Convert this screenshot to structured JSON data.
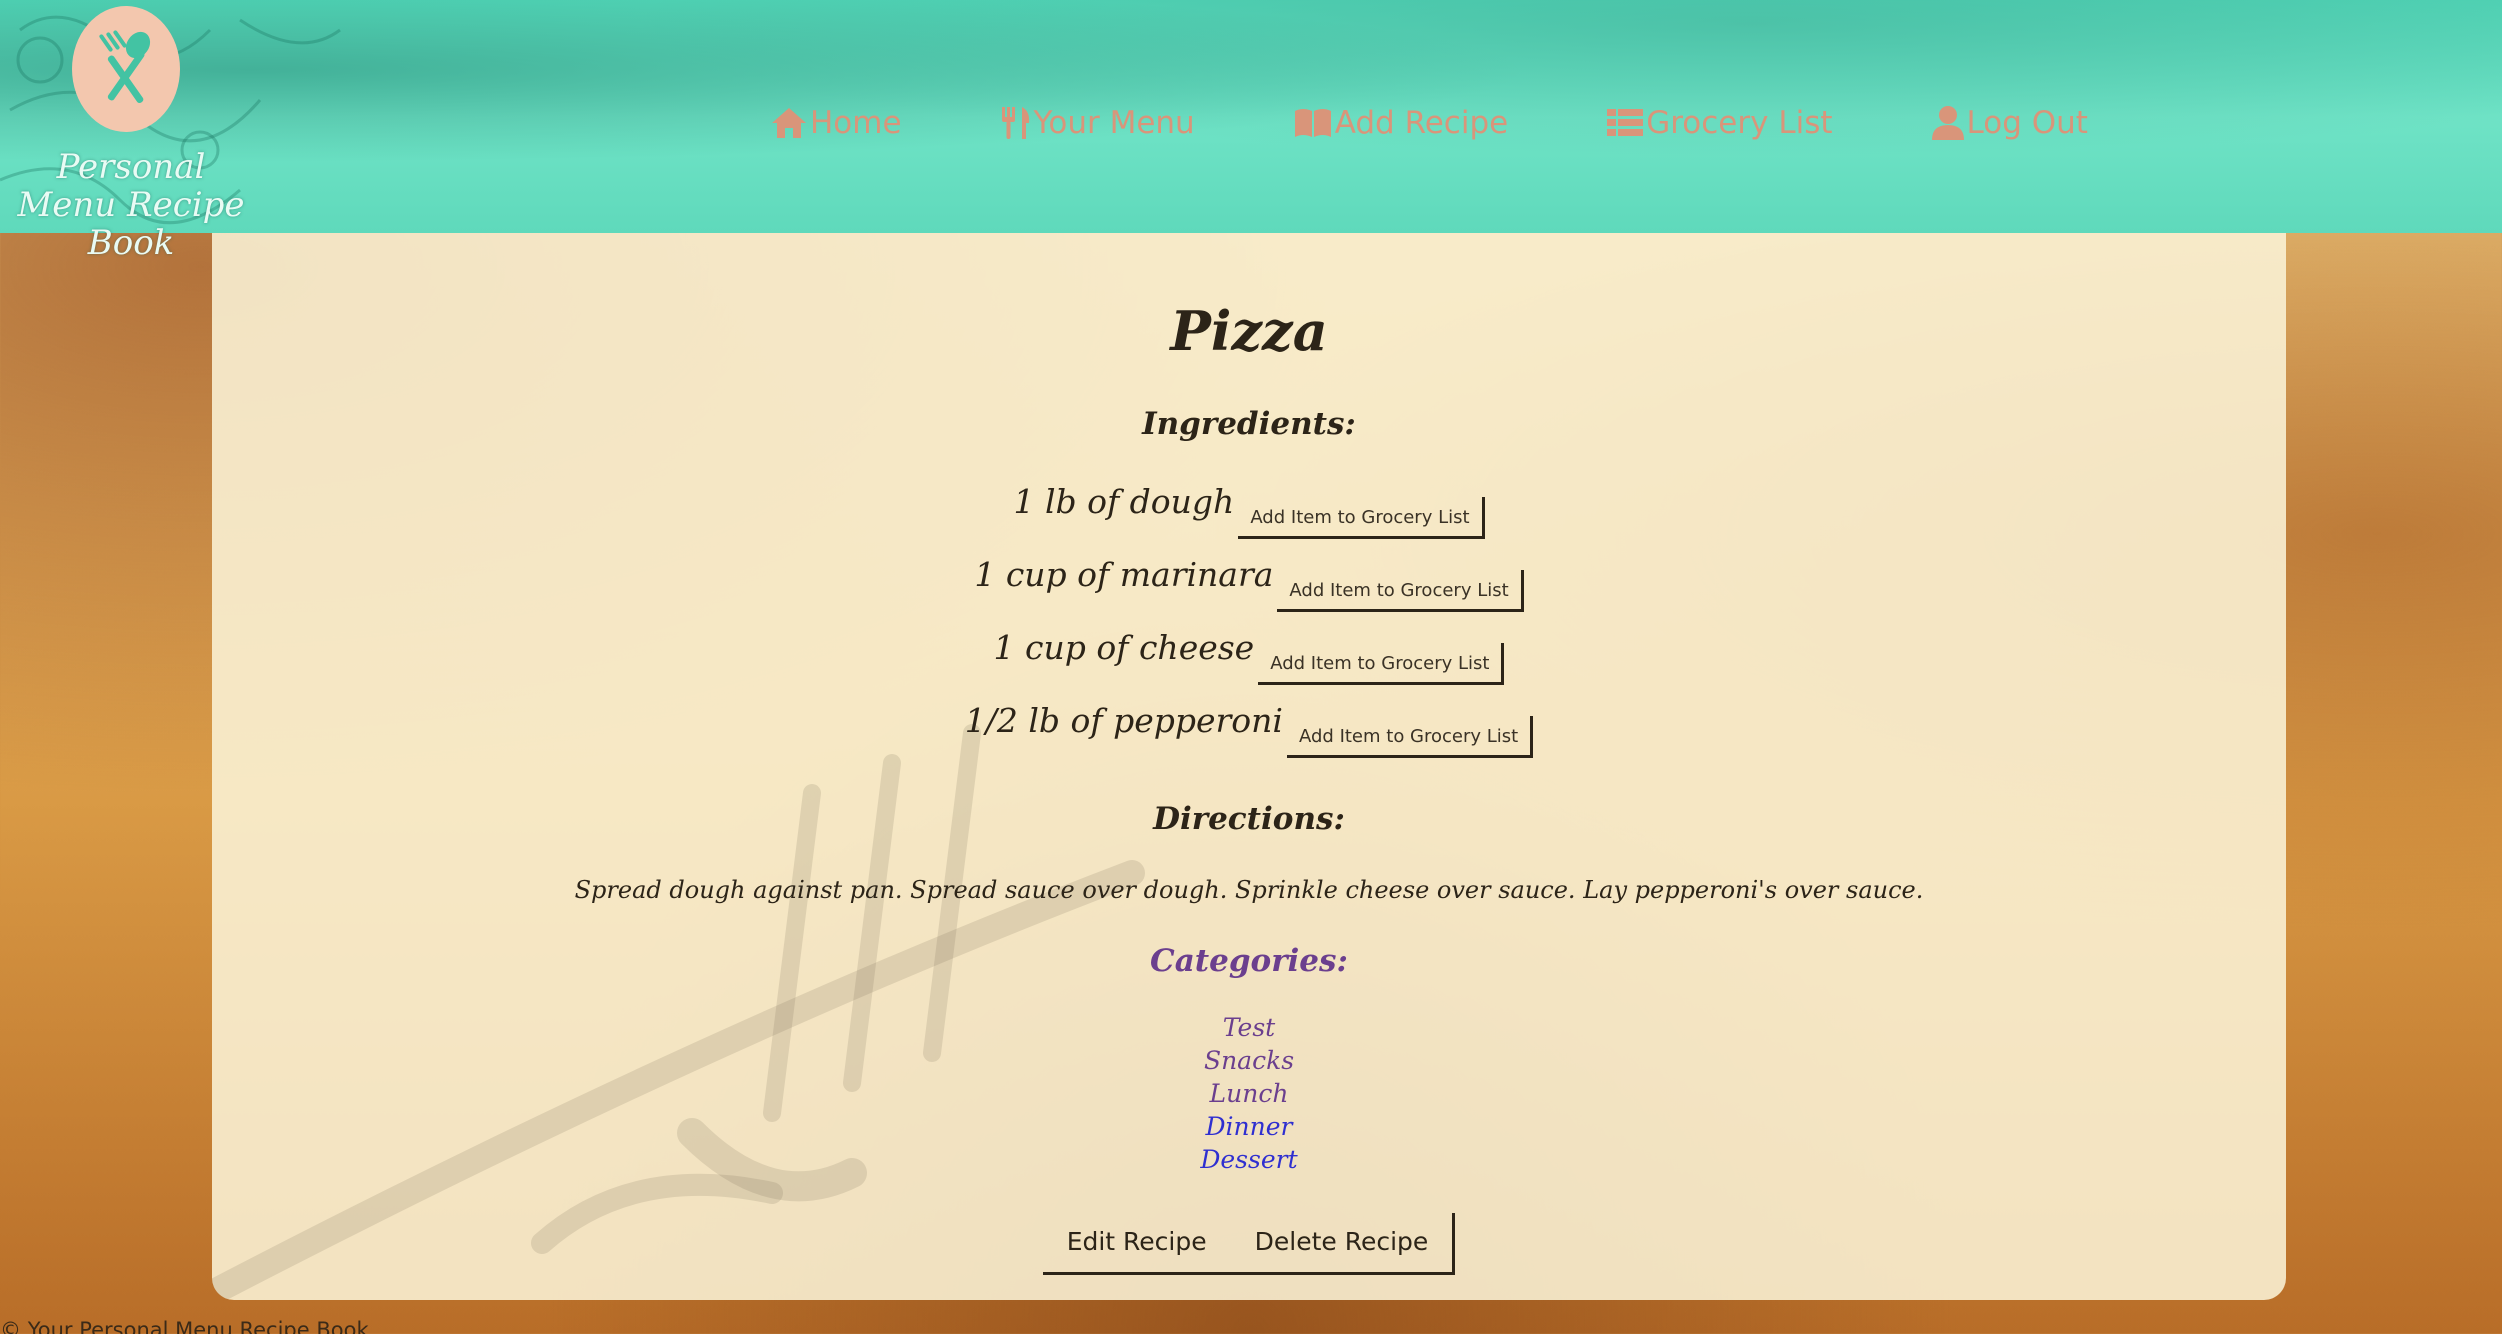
{
  "brand": {
    "line1": "Personal",
    "line2": "Menu Recipe Book"
  },
  "nav": {
    "home": "Home",
    "your_menu": "Your Menu",
    "add_recipe": "Add Recipe",
    "grocery_list": "Grocery List",
    "log_out": "Log Out"
  },
  "recipe": {
    "title": "Pizza",
    "ingredients_heading": "Ingredients:",
    "ingredients": [
      {
        "text": "1 lb of dough",
        "button": "Add Item to Grocery List"
      },
      {
        "text": "1 cup of marinara",
        "button": "Add Item to Grocery List"
      },
      {
        "text": "1 cup of cheese",
        "button": "Add Item to Grocery List"
      },
      {
        "text": "1/2 lb of pepperoni",
        "button": "Add Item to Grocery List"
      }
    ],
    "directions_heading": "Directions:",
    "directions": "Spread dough against pan. Spread sauce over dough. Sprinkle cheese over sauce. Lay pepperoni's over sauce.",
    "categories_heading": "Categories:",
    "categories": [
      "Test",
      "Snacks",
      "Lunch",
      "Dinner",
      "Dessert"
    ]
  },
  "actions": {
    "edit": "Edit Recipe",
    "delete": "Delete Recipe"
  },
  "footer": {
    "copyright_symbol": "©",
    "text": "Your Personal Menu Recipe Book"
  },
  "colors": {
    "header": "#6fe3c6",
    "nav_text": "#d9957a",
    "card": "#fbf3d6",
    "text": "#2c2418",
    "category_visited": "#6b3f8e",
    "category_link": "#2f2fd0"
  },
  "icons": {
    "logo": "fork-spoon-icon",
    "home": "home-icon",
    "your_menu": "utensils-icon",
    "add_recipe": "book-icon",
    "grocery_list": "list-icon",
    "log_out": "user-icon"
  }
}
